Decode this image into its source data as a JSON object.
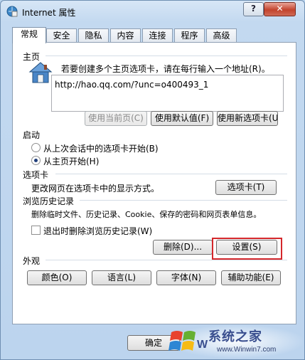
{
  "window": {
    "title": "Internet 属性",
    "help_label": "?",
    "close_label": "✕"
  },
  "tabs": [
    {
      "label": "常规"
    },
    {
      "label": "安全"
    },
    {
      "label": "隐私"
    },
    {
      "label": "内容"
    },
    {
      "label": "连接"
    },
    {
      "label": "程序"
    },
    {
      "label": "高级"
    }
  ],
  "home": {
    "title": "主页",
    "description": "若要创建多个主页选项卡，请在每行输入一个地址(R)。",
    "url": "http://hao.qq.com/?unc=o400493_1",
    "use_current": "使用当前页(C)",
    "use_default": "使用默认值(F)",
    "use_new_tab": "使用新选项卡(U)"
  },
  "startup": {
    "title": "启动",
    "option1": "从上次会话中的选项卡开始(B)",
    "option2": "从主页开始(H)",
    "selected": "option2"
  },
  "tabs_section": {
    "title": "选项卡",
    "description": "更改网页在选项卡中的显示方式。",
    "button": "选项卡(T)"
  },
  "history": {
    "title": "浏览历史记录",
    "description": "删除临时文件、历史记录、Cookie、保存的密码和网页表单信息。",
    "checkbox": "退出时删除浏览历史记录(W)",
    "delete_button": "删除(D)...",
    "settings_button": "设置(S)"
  },
  "appearance": {
    "title": "外观",
    "colors": "颜色(O)",
    "languages": "语言(L)",
    "fonts": "字体(N)",
    "accessibility": "辅助功能(E)"
  },
  "footer": {
    "ok": "确定"
  },
  "watermark": {
    "text": "系统之家",
    "url": "www.Winwin7.com"
  },
  "colors": {
    "highlight": "#d4272b",
    "titlebar": "#c3d9f0",
    "close": "#c2432d"
  }
}
